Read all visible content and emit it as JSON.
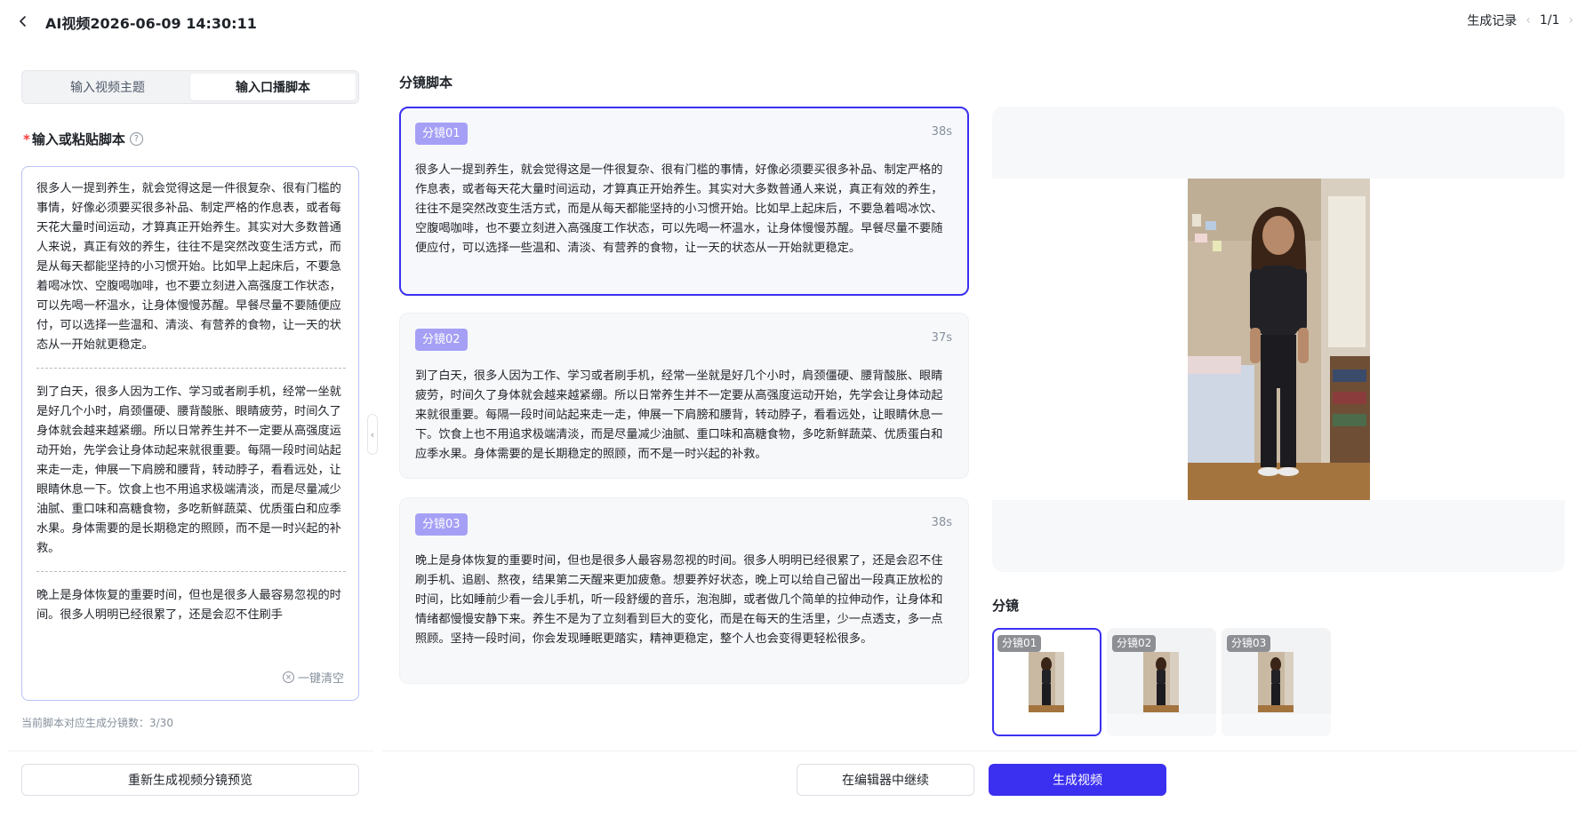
{
  "header": {
    "title": "AI视频2026-06-09 14:30:11",
    "history_label": "生成记录",
    "pager": "1/1",
    "prev_glyph": "‹",
    "next_glyph": "›"
  },
  "left": {
    "tabs": [
      {
        "label": "输入视频主题",
        "active": false
      },
      {
        "label": "输入口播脚本",
        "active": true
      }
    ],
    "field_required_mark": "*",
    "field_label": "输入或粘贴脚本",
    "help_glyph": "?",
    "script_paragraphs": [
      "很多人一提到养生，就会觉得这是一件很复杂、很有门槛的事情，好像必须要买很多补品、制定严格的作息表，或者每天花大量时间运动，才算真正开始养生。其实对大多数普通人来说，真正有效的养生，往往不是突然改变生活方式，而是从每天都能坚持的小习惯开始。比如早上起床后，不要急着喝冰饮、空腹喝咖啡，也不要立刻进入高强度工作状态，可以先喝一杯温水，让身体慢慢苏醒。早餐尽量不要随便应付，可以选择一些温和、清淡、有营养的食物，让一天的状态从一开始就更稳定。",
      "到了白天，很多人因为工作、学习或者刷手机，经常一坐就是好几个小时，肩颈僵硬、腰背酸胀、眼睛疲劳，时间久了身体就会越来越紧绷。所以日常养生并不一定要从高强度运动开始，先学会让身体动起来就很重要。每隔一段时间站起来走一走，伸展一下肩膀和腰背，转动脖子，看看远处，让眼睛休息一下。饮食上也不用追求极端清淡，而是尽量减少油腻、重口味和高糖食物，多吃新鲜蔬菜、优质蛋白和应季水果。身体需要的是长期稳定的照顾，而不是一时兴起的补救。",
      "晚上是身体恢复的重要时间，但也是很多人最容易忽视的时间。很多人明明已经很累了，还是会忍不住刷手"
    ],
    "clear_icon_glyph": "×",
    "clear_label": "一键清空",
    "seg_count_text": "当前脚本对应生成分镜数：3/30",
    "collapse_glyph": "‹",
    "regen_button": "重新生成视频分镜预览"
  },
  "middle": {
    "title": "分镜脚本",
    "cards": [
      {
        "tag": "分镜01",
        "duration": "38s",
        "active": true,
        "text": "很多人一提到养生，就会觉得这是一件很复杂、很有门槛的事情，好像必须要买很多补品、制定严格的作息表，或者每天花大量时间运动，才算真正开始养生。其实对大多数普通人来说，真正有效的养生，往往不是突然改变生活方式，而是从每天都能坚持的小习惯开始。比如早上起床后，不要急着喝冰饮、空腹喝咖啡，也不要立刻进入高强度工作状态，可以先喝一杯温水，让身体慢慢苏醒。早餐尽量不要随便应付，可以选择一些温和、清淡、有营养的食物，让一天的状态从一开始就更稳定。"
      },
      {
        "tag": "分镜02",
        "duration": "37s",
        "active": false,
        "text": "到了白天，很多人因为工作、学习或者刷手机，经常一坐就是好几个小时，肩颈僵硬、腰背酸胀、眼睛疲劳，时间久了身体就会越来越紧绷。所以日常养生并不一定要从高强度运动开始，先学会让身体动起来就很重要。每隔一段时间站起来走一走，伸展一下肩膀和腰背，转动脖子，看看远处，让眼睛休息一下。饮食上也不用追求极端清淡，而是尽量减少油腻、重口味和高糖食物，多吃新鲜蔬菜、优质蛋白和应季水果。身体需要的是长期稳定的照顾，而不是一时兴起的补救。"
      },
      {
        "tag": "分镜03",
        "duration": "38s",
        "active": false,
        "text": "晚上是身体恢复的重要时间，但也是很多人最容易忽视的时间。很多人明明已经很累了，还是会忍不住刷手机、追剧、熬夜，结果第二天醒来更加疲惫。想要养好状态，晚上可以给自己留出一段真正放松的时间，比如睡前少看一会儿手机，听一段舒缓的音乐，泡泡脚，或者做几个简单的拉伸动作，让身体和情绪都慢慢安静下来。养生不是为了立刻看到巨大的变化，而是在每天的生活里，少一点透支，多一点照顾。坚持一段时间，你会发现睡眠更踏实，精神更稳定，整个人也会变得更轻松很多。"
      }
    ]
  },
  "right": {
    "shots_title": "分镜",
    "shots": [
      {
        "tag": "分镜01",
        "active": true
      },
      {
        "tag": "分镜02",
        "active": false
      },
      {
        "tag": "分镜03",
        "active": false
      }
    ]
  },
  "footer": {
    "continue_button": "在编辑器中继续",
    "generate_button": "生成视频"
  },
  "colors": {
    "accent": "#3b30f0",
    "tag_purple": "#a5a0f5",
    "required": "#f53f3f"
  },
  "icons": {
    "back": "chevron-left-icon",
    "help": "question-circle-icon",
    "clear": "close-circle-icon"
  }
}
